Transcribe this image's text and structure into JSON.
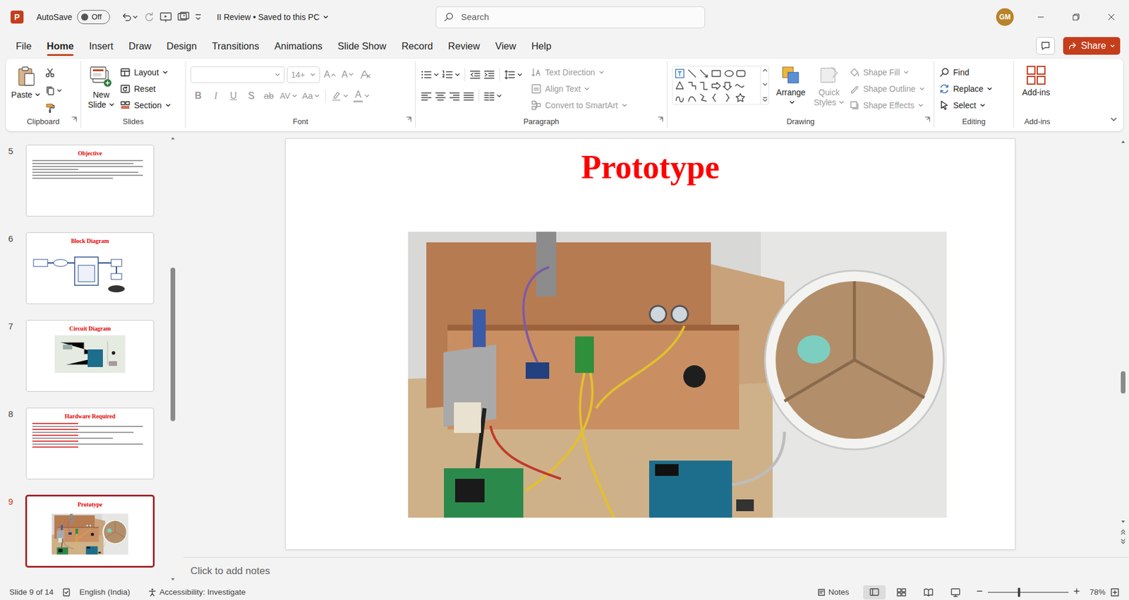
{
  "window": {
    "app_letter": "P",
    "title": "II Review • Saved to this PC"
  },
  "autosave": {
    "label": "AutoSave",
    "state": "Off",
    "on": false
  },
  "search": {
    "placeholder": "Search"
  },
  "account": {
    "initials": "GM"
  },
  "tabs": [
    {
      "label": "File",
      "selected": false
    },
    {
      "label": "Home",
      "selected": true
    },
    {
      "label": "Insert",
      "selected": false
    },
    {
      "label": "Draw",
      "selected": false
    },
    {
      "label": "Design",
      "selected": false
    },
    {
      "label": "Transitions",
      "selected": false
    },
    {
      "label": "Animations",
      "selected": false
    },
    {
      "label": "Slide Show",
      "selected": false
    },
    {
      "label": "Record",
      "selected": false
    },
    {
      "label": "Review",
      "selected": false
    },
    {
      "label": "View",
      "selected": false
    },
    {
      "label": "Help",
      "selected": false
    }
  ],
  "share": {
    "label": "Share"
  },
  "ribbon": {
    "clipboard": {
      "label": "Clipboard",
      "paste": {
        "label": "Paste",
        "disabled": false
      }
    },
    "slides": {
      "label": "Slides",
      "new_slide": {
        "label": "New Slide",
        "disabled": false
      },
      "items": [
        {
          "label": "Layout",
          "disabled": false
        },
        {
          "label": "Reset",
          "disabled": false
        },
        {
          "label": "Section",
          "disabled": false
        }
      ]
    },
    "font": {
      "label": "Font",
      "size": "14+",
      "grow": "A",
      "shrink": "A",
      "formats": [
        "B",
        "I",
        "U",
        "S",
        "ab",
        "AV",
        "Aa"
      ],
      "font_color": "A",
      "disabled": true
    },
    "paragraph": {
      "label": "Paragraph",
      "disabled": true,
      "items": [
        {
          "label": "Text Direction",
          "disabled": true
        },
        {
          "label": "Align Text",
          "disabled": true
        },
        {
          "label": "Convert to SmartArt",
          "disabled": true
        }
      ]
    },
    "drawing": {
      "label": "Drawing",
      "arrange": {
        "label": "Arrange",
        "disabled": false
      },
      "quick_styles": {
        "label": "Quick Styles",
        "disabled": true
      },
      "items": [
        {
          "label": "Shape Fill",
          "disabled": true
        },
        {
          "label": "Shape Outline",
          "disabled": true
        },
        {
          "label": "Shape Effects",
          "disabled": true
        }
      ]
    },
    "editing": {
      "label": "Editing",
      "items": [
        {
          "label": "Find",
          "disabled": false
        },
        {
          "label": "Replace",
          "disabled": false
        },
        {
          "label": "Select",
          "disabled": false
        }
      ]
    },
    "addins": {
      "label": "Add-ins",
      "button": {
        "label": "Add-ins",
        "disabled": false
      }
    }
  },
  "thumbnails": [
    {
      "number": "5",
      "title": "Objective",
      "kind": "text",
      "selected": false
    },
    {
      "number": "6",
      "title": "Block Diagram",
      "kind": "diagram",
      "selected": false
    },
    {
      "number": "7",
      "title": "Circuit Diagram",
      "kind": "circuit",
      "selected": false
    },
    {
      "number": "8",
      "title": "Hardware Required",
      "kind": "list",
      "selected": false
    },
    {
      "number": "9",
      "title": "Prototype",
      "kind": "photo",
      "selected": true
    }
  ],
  "slide": {
    "title": "Prototype"
  },
  "notes": {
    "placeholder": "Click to add notes"
  },
  "status_bar": {
    "slide": "Slide 9 of 14",
    "language": "English (India)",
    "accessibility": "Accessibility: Investigate",
    "notes": "Notes",
    "views": [
      {
        "selected": true
      },
      {
        "selected": false
      },
      {
        "selected": false
      },
      {
        "selected": false
      }
    ],
    "zoom": "78%",
    "zoom_level": 0.39
  }
}
